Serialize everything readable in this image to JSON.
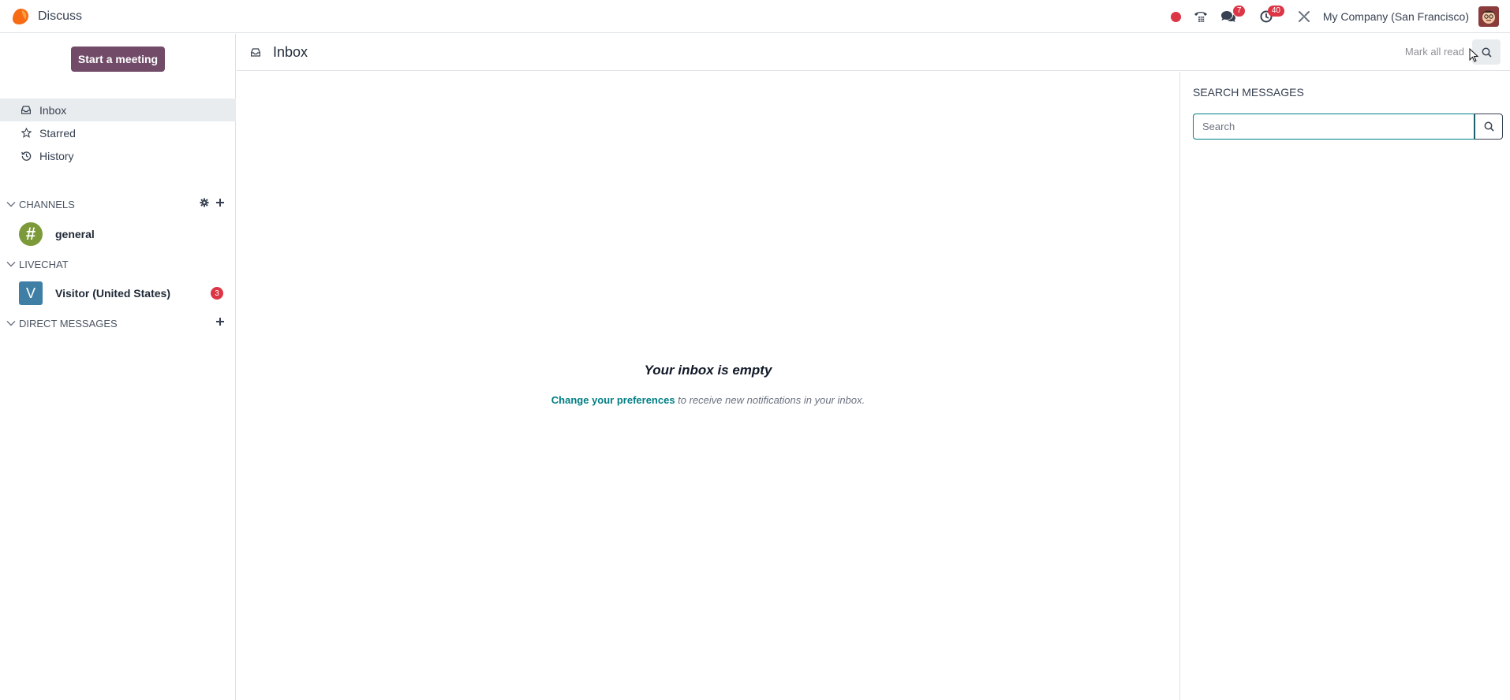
{
  "app": {
    "name": "Discuss",
    "logo_color": "#f76b15"
  },
  "navbar": {
    "messages_badge": "7",
    "activities_badge": "40",
    "company": "My Company (San Francisco)",
    "icons": [
      "record-dot-icon",
      "phone-dialpad-icon",
      "chat-bubbles-icon",
      "clock-icon",
      "tools-icon"
    ]
  },
  "sidebar": {
    "start_meeting": "Start a meeting",
    "links": [
      {
        "label": "Inbox",
        "icon": "inbox-icon",
        "active": true
      },
      {
        "label": "Starred",
        "icon": "star-icon",
        "active": false
      },
      {
        "label": "History",
        "icon": "history-icon",
        "active": false
      }
    ],
    "categories": {
      "channels": "CHANNELS",
      "livechat": "LIVECHAT",
      "direct_messages": "DIRECT MESSAGES"
    },
    "channels": [
      {
        "name": "general",
        "avatar": "#",
        "color": "#7c9a3a"
      }
    ],
    "livechats": [
      {
        "name": "Visitor (United States)",
        "avatar": "V",
        "color": "#3f7fa6",
        "badge": "3"
      }
    ]
  },
  "thread": {
    "title": "Inbox",
    "mark_all_read": "Mark all read",
    "empty_title": "Your inbox is empty",
    "empty_link": "Change your preferences",
    "empty_rest": " to receive new notifications in your inbox."
  },
  "search_panel": {
    "title": "SEARCH MESSAGES",
    "placeholder": "Search"
  },
  "colors": {
    "primary": "#714B67",
    "link": "#017e84",
    "badge": "#dc3545"
  }
}
